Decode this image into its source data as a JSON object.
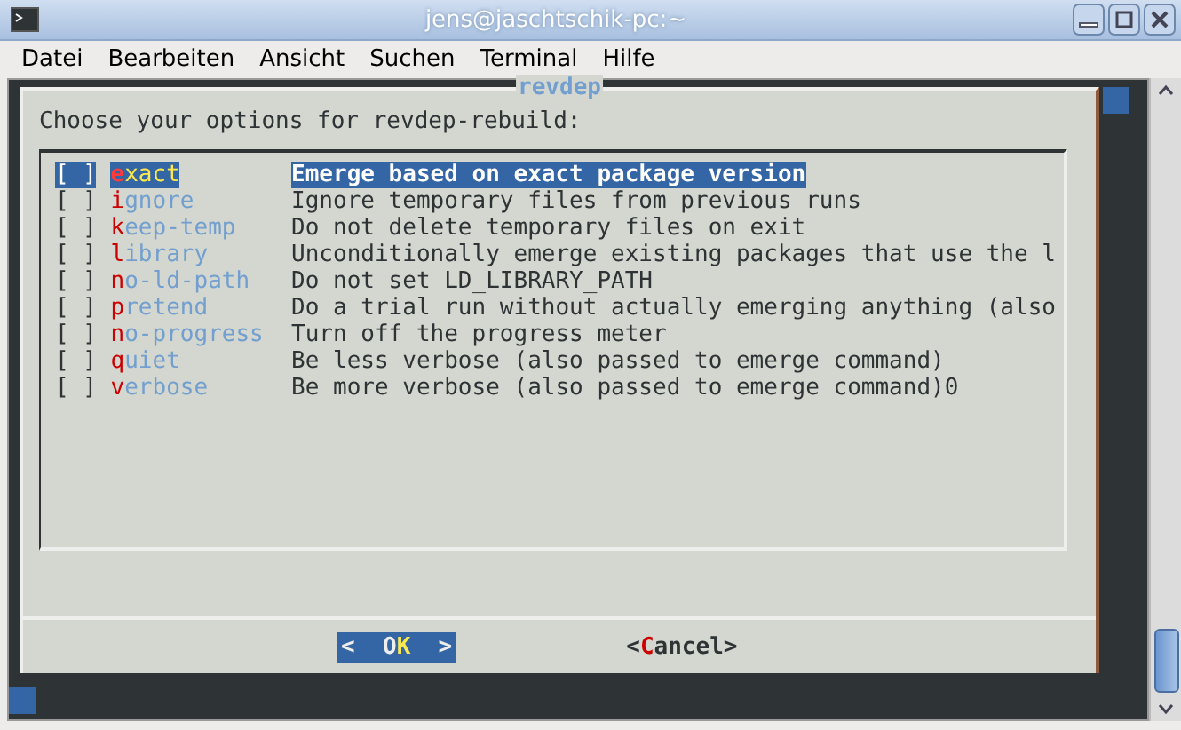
{
  "window": {
    "title": "jens@jaschtschik-pc:~"
  },
  "menu": [
    "Datei",
    "Bearbeiten",
    "Ansicht",
    "Suchen",
    "Terminal",
    "Hilfe"
  ],
  "dialog": {
    "title": "revdep",
    "prompt": "Choose your options for revdep-rebuild:",
    "options": [
      {
        "box": "[ ]",
        "hotkey": "e",
        "rest": "xact",
        "desc": "Emerge based on exact package version",
        "selected": true
      },
      {
        "box": "[ ]",
        "hotkey": "i",
        "rest": "gnore",
        "desc": "Ignore temporary files from previous runs",
        "selected": false
      },
      {
        "box": "[ ]",
        "hotkey": "k",
        "rest": "eep-temp",
        "desc": "Do not delete temporary files on exit",
        "selected": false
      },
      {
        "box": "[ ]",
        "hotkey": "l",
        "rest": "ibrary",
        "desc": "Unconditionally emerge existing packages that use the l",
        "selected": false
      },
      {
        "box": "[ ]",
        "hotkey": "n",
        "rest": "o-ld-path",
        "desc": "Do not set LD_LIBRARY_PATH",
        "selected": false
      },
      {
        "box": "[ ]",
        "hotkey": "p",
        "rest": "retend",
        "desc": "Do a trial run without actually emerging anything (also",
        "selected": false
      },
      {
        "box": "[ ]",
        "hotkey": "n",
        "rest": "o-progress",
        "desc": "Turn off the progress meter",
        "selected": false
      },
      {
        "box": "[ ]",
        "hotkey": "q",
        "rest": "uiet",
        "desc": "Be less verbose (also passed to emerge command)",
        "selected": false
      },
      {
        "box": "[ ]",
        "hotkey": "v",
        "rest": "erbose",
        "desc": "Be more verbose (also passed to emerge command)0",
        "selected": false
      }
    ],
    "buttons": [
      {
        "before": "<  O",
        "hotkey": "K",
        "after": "  >",
        "selected": true
      },
      {
        "before": "<",
        "hotkey": "C",
        "after": "ancel>",
        "selected": false
      }
    ]
  }
}
